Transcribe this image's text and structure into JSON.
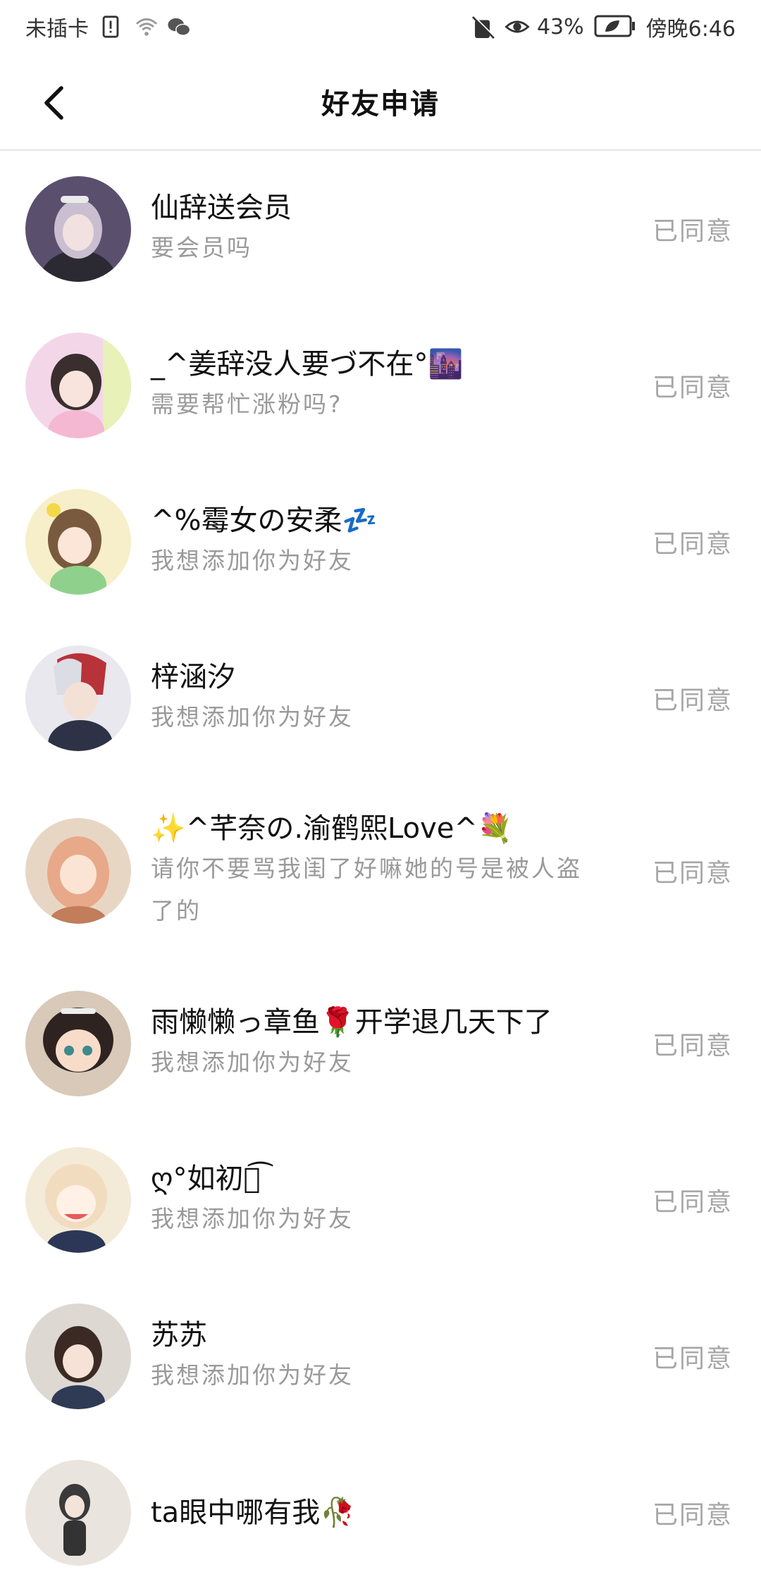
{
  "status_bar": {
    "carrier": "未插卡",
    "battery_percent": "43%",
    "time": "傍晚6:46"
  },
  "header": {
    "title": "好友申请"
  },
  "requests": [
    {
      "name": "仙辞送会员",
      "message": "要会员吗",
      "status": "已同意",
      "avatar_color": "#5b4f6e"
    },
    {
      "name": "_^姜辞没人要づ不在°🌆",
      "message": "需要帮忙涨粉吗?",
      "status": "已同意",
      "avatar_color": "#f3d7e8"
    },
    {
      "name": "^%霉女の安柔💤",
      "message": "我想添加你为好友",
      "status": "已同意",
      "avatar_color": "#f6efc9"
    },
    {
      "name": "梓涵汐",
      "message": "我想添加你为好友",
      "status": "已同意",
      "avatar_color": "#3d4660"
    },
    {
      "name": "✨^芊奈の.渝鹤熙Love^💐",
      "message": "请你不要骂我闺了好嘛她的号是被人盗了的",
      "status": "已同意",
      "avatar_color": "#e8d6c5"
    },
    {
      "name": "雨懒懒っ章鱼🌹开学退几天下了",
      "message": "我想添加你为好友",
      "status": "已同意",
      "avatar_color": "#7a5a48"
    },
    {
      "name": "ღ°如初ེ͡ ",
      "message": "我想添加你为好友",
      "status": "已同意",
      "avatar_color": "#f4ead8"
    },
    {
      "name": "苏苏",
      "message": "我想添加你为好友",
      "status": "已同意",
      "avatar_color": "#ddd8d2"
    },
    {
      "name": "ta眼中哪有我🥀",
      "message": "",
      "status": "已同意",
      "avatar_color": "#e9e4dd"
    }
  ]
}
